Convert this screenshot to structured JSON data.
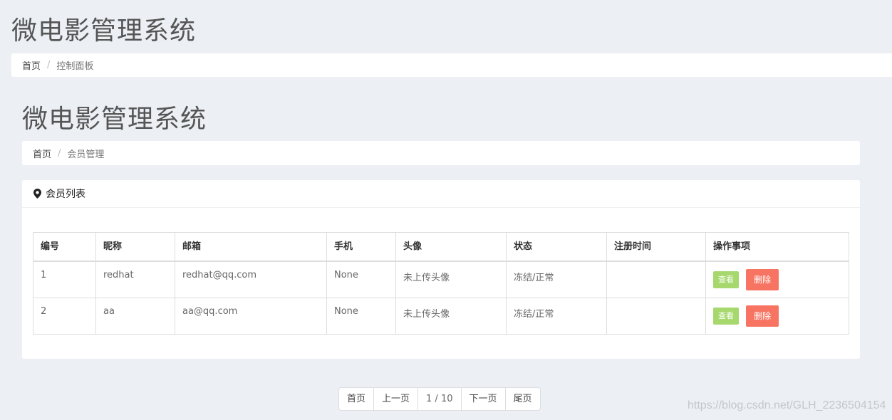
{
  "outer": {
    "title": "微电影管理系统",
    "breadcrumb": {
      "home": "首页",
      "separator": "/",
      "current": "控制面板"
    }
  },
  "inner": {
    "title": "微电影管理系统",
    "breadcrumb": {
      "home": "首页",
      "separator": "/",
      "current": "会员管理"
    }
  },
  "box": {
    "icon": "map-marker-icon",
    "title": "会员列表",
    "columns": [
      "编号",
      "昵称",
      "邮箱",
      "手机",
      "头像",
      "状态",
      "注册时间",
      "操作事项"
    ],
    "rows": [
      {
        "id": "1",
        "nickname": "redhat",
        "email": "redhat@qq.com",
        "phone": "None",
        "avatar": "未上传头像",
        "status": "冻结/正常",
        "registered": "",
        "view_label": "查看",
        "delete_label": "删除"
      },
      {
        "id": "2",
        "nickname": "aa",
        "email": "aa@qq.com",
        "phone": "None",
        "avatar": "未上传头像",
        "status": "冻结/正常",
        "registered": "",
        "view_label": "查看",
        "delete_label": "删除"
      }
    ]
  },
  "pager": {
    "first": "首页",
    "prev": "上一页",
    "info": "1 / 10",
    "next": "下一页",
    "last": "尾页"
  },
  "watermark": "https://blog.csdn.net/GLH_2236504154",
  "colors": {
    "view_button": "#a6d86e",
    "delete_button": "#f87462",
    "background": "#ecf0f5"
  }
}
